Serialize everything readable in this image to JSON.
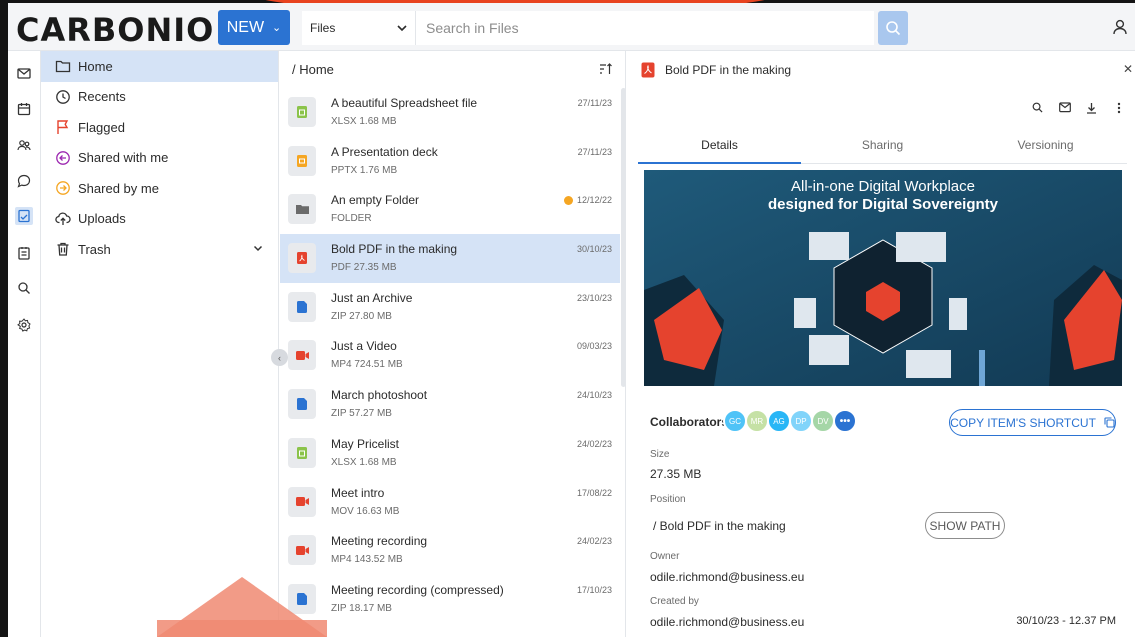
{
  "app": {
    "logo": "CARBONIO"
  },
  "topbar": {
    "new_label": "NEW",
    "module": "Files",
    "search_placeholder": "Search in Files"
  },
  "rail": {
    "items": [
      "mail-icon",
      "calendar-icon",
      "contacts-icon",
      "chats-icon",
      "files-icon",
      "tasks-icon",
      "search-icon",
      "settings-icon"
    ],
    "active": "files-icon"
  },
  "tree": {
    "items": [
      {
        "label": "Home",
        "icon": "folder-icon",
        "active": true
      },
      {
        "label": "Recents",
        "icon": "clock-icon"
      },
      {
        "label": "Flagged",
        "icon": "flag-icon"
      },
      {
        "label": "Shared with me",
        "icon": "shared-in-icon"
      },
      {
        "label": "Shared by me",
        "icon": "shared-out-icon"
      },
      {
        "label": "Uploads",
        "icon": "upload-icon"
      },
      {
        "label": "Trash",
        "icon": "trash-icon",
        "expandable": true
      }
    ]
  },
  "list": {
    "breadcrumb": "/ Home",
    "rows": [
      {
        "name": "A beautiful Spreadsheet file",
        "meta": "XLSX  1.68 MB",
        "date": "27/11/23",
        "type": "xlsx"
      },
      {
        "name": "A Presentation deck",
        "meta": "PPTX  1.76 MB",
        "date": "27/11/23",
        "type": "pptx"
      },
      {
        "name": "An empty Folder",
        "meta": "FOLDER",
        "date": "12/12/22",
        "type": "folder",
        "shared": true
      },
      {
        "name": "Bold PDF in the making",
        "meta": "PDF  27.35 MB",
        "date": "30/10/23",
        "type": "pdf",
        "selected": true
      },
      {
        "name": "Just an Archive",
        "meta": "ZIP  27.80 MB",
        "date": "23/10/23",
        "type": "zip"
      },
      {
        "name": "Just a Video",
        "meta": "MP4  724.51 MB",
        "date": "09/03/23",
        "type": "video"
      },
      {
        "name": "March photoshoot",
        "meta": "ZIP  57.27 MB",
        "date": "24/10/23",
        "type": "zip"
      },
      {
        "name": "May Pricelist",
        "meta": "XLSX  1.68 MB",
        "date": "24/02/23",
        "type": "xlsx"
      },
      {
        "name": "Meet intro",
        "meta": "MOV  16.63 MB",
        "date": "17/08/22",
        "type": "video"
      },
      {
        "name": "Meeting recording",
        "meta": "MP4  143.52 MB",
        "date": "24/02/23",
        "type": "video"
      },
      {
        "name": "Meeting recording (compressed)",
        "meta": "ZIP  18.17 MB",
        "date": "17/10/23",
        "type": "zip"
      }
    ]
  },
  "preview": {
    "title": "Bold PDF in the making",
    "tabs": [
      "Details",
      "Sharing",
      "Versioning"
    ],
    "active_tab": "Details",
    "banner_line1": "All-in-one Digital Workplace",
    "banner_line2": "designed for Digital Sovereignty",
    "collaborators_label": "Collaborators",
    "collaborators": [
      {
        "initials": "GC",
        "color": "#4fc3f7"
      },
      {
        "initials": "MR",
        "color": "#c5e1a5"
      },
      {
        "initials": "AG",
        "color": "#29b6f6"
      },
      {
        "initials": "DP",
        "color": "#81d4fa"
      },
      {
        "initials": "DV",
        "color": "#a5d6a7"
      }
    ],
    "shortcut_label": "COPY ITEM'S SHORTCUT",
    "size_label": "Size",
    "size_value": "27.35 MB",
    "position_label": "Position",
    "position_value": "/  Bold PDF in the making",
    "show_path_label": "SHOW PATH",
    "owner_label": "Owner",
    "owner_value": "odile.richmond@business.eu",
    "created_label": "Created by",
    "created_value": "odile.richmond@business.eu",
    "created_date": "30/10/23 - 12.37 PM"
  },
  "colors": {
    "accent": "#2b73d2",
    "selected": "#d5e3f6",
    "pdf": "#e5432e",
    "xlsx": "#8bc34a",
    "pptx": "#f5a623",
    "zip": "#2b73d2",
    "video": "#e5432e",
    "folder": "#6b6b6b"
  }
}
